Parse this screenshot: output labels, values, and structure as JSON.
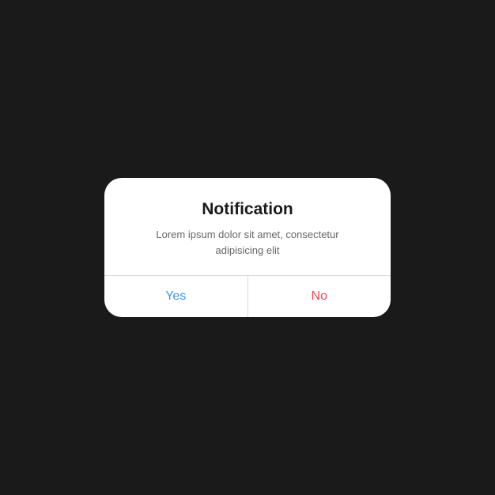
{
  "dialog": {
    "title": "Notification",
    "message": "Lorem ipsum dolor sit amet, consectetur adipisicing elit",
    "yes_label": "Yes",
    "no_label": "No"
  }
}
